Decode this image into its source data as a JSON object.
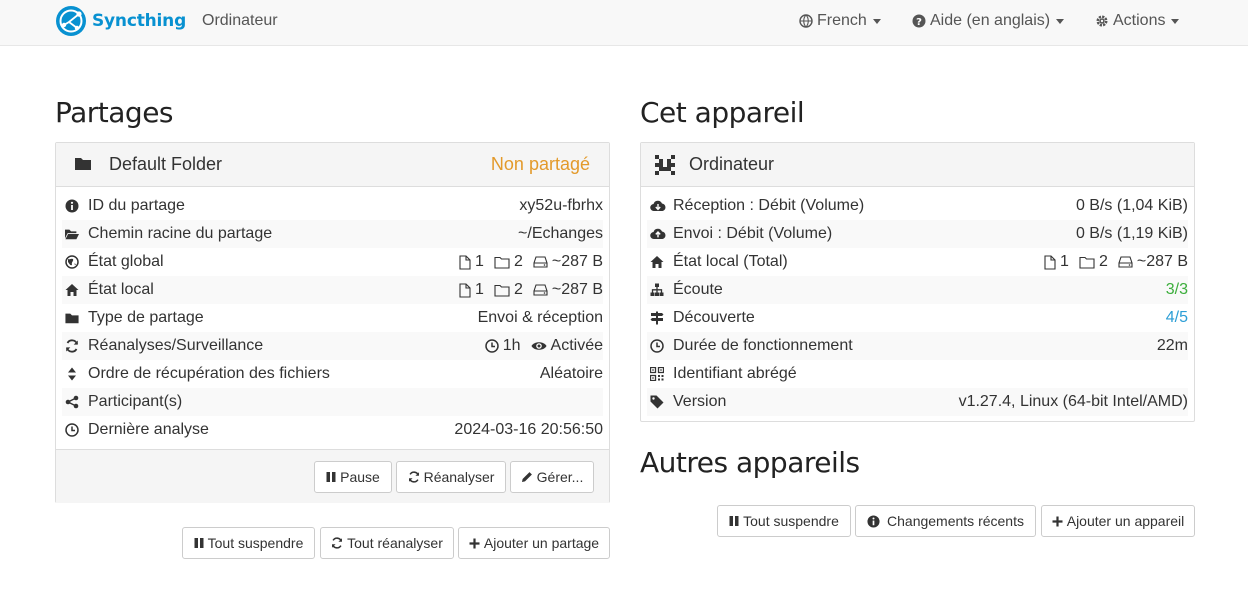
{
  "navbar": {
    "brand": "Syncthing",
    "device_name": "Ordinateur",
    "language": "French",
    "help": "Aide (en anglais)",
    "actions": "Actions"
  },
  "folders_section": {
    "title": "Partages",
    "folder": {
      "name": "Default Folder",
      "status": "Non partagé",
      "rows": [
        {
          "label": "ID du partage",
          "value": "xy52u-fbrhx"
        },
        {
          "label": "Chemin racine du partage",
          "value": "~/Echanges"
        },
        {
          "label": "État global",
          "files": "1",
          "dirs": "2",
          "size": "~287 B"
        },
        {
          "label": "État local",
          "files": "1",
          "dirs": "2",
          "size": "~287 B"
        },
        {
          "label": "Type de partage",
          "value": "Envoi & réception"
        },
        {
          "label": "Réanalyses/Surveillance",
          "interval": "1h",
          "watch": "Activée"
        },
        {
          "label": "Ordre de récupération des fichiers",
          "value": "Aléatoire"
        },
        {
          "label": "Participant(s)",
          "value": ""
        },
        {
          "label": "Dernière analyse",
          "value": "2024-03-16 20:56:50"
        }
      ],
      "buttons": {
        "pause": "Pause",
        "rescan": "Réanalyser",
        "edit": "Gérer..."
      }
    },
    "buttons": {
      "pause_all": "Tout suspendre",
      "rescan_all": "Tout réanalyser",
      "add_folder": "Ajouter un partage"
    }
  },
  "device_section": {
    "title": "Cet appareil",
    "device": {
      "name": "Ordinateur",
      "rows": [
        {
          "label": "Réception : Débit (Volume)",
          "value": "0 B/s (1,04 KiB)"
        },
        {
          "label": "Envoi : Débit (Volume)",
          "value": "0 B/s (1,19 KiB)"
        },
        {
          "label": "État local (Total)",
          "files": "1",
          "dirs": "2",
          "size": "~287 B"
        },
        {
          "label": "Écoute",
          "value": "3/3"
        },
        {
          "label": "Découverte",
          "value": "4/5"
        },
        {
          "label": "Durée de fonctionnement",
          "value": "22m"
        },
        {
          "label": "Identifiant abrégé",
          "value": ""
        },
        {
          "label": "Version",
          "value": "v1.27.4, Linux (64-bit Intel/AMD)"
        }
      ]
    }
  },
  "remote_section": {
    "title": "Autres appareils",
    "buttons": {
      "pause_all": "Tout suspendre",
      "recent_changes": "Changements récents",
      "add_device": "Ajouter un appareil"
    }
  },
  "colors": {
    "brand": "#0891d1",
    "unshared": "#e39a2b",
    "ok": "#3cae3c",
    "info": "#2c9ed6"
  }
}
